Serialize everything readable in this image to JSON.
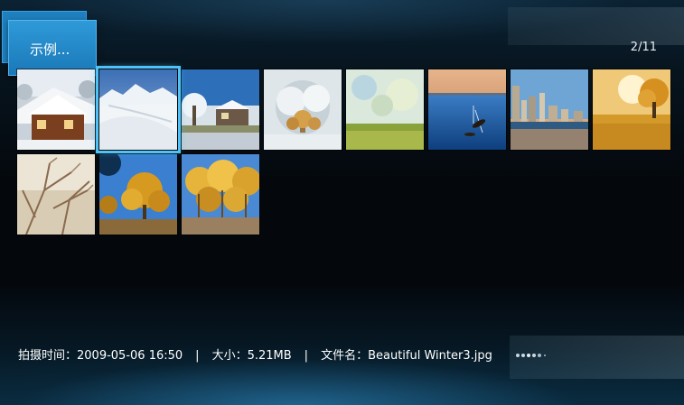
{
  "header": {
    "folder_label": "示例...",
    "page_indicator": "2/11"
  },
  "thumbnails": [
    {
      "name": "thumb-snow-cabin",
      "scene": "snow cabin"
    },
    {
      "name": "thumb-snow-slope",
      "scene": "snow slope",
      "selected": true
    },
    {
      "name": "thumb-winter-house",
      "scene": "winter house"
    },
    {
      "name": "thumb-frost-tree",
      "scene": "frost tree"
    },
    {
      "name": "thumb-green-field",
      "scene": "green field"
    },
    {
      "name": "thumb-sunset-boat",
      "scene": "sunset boat"
    },
    {
      "name": "thumb-city-waterfront",
      "scene": "city waterfront"
    },
    {
      "name": "thumb-autumn-tree",
      "scene": "autumn tree"
    },
    {
      "name": "thumb-bare-branches",
      "scene": "bare branches"
    },
    {
      "name": "thumb-yellow-trees",
      "scene": "yellow trees"
    },
    {
      "name": "thumb-golden-forest",
      "scene": "golden forest"
    }
  ],
  "status": {
    "capture_time_label": "拍摄时间：",
    "capture_time_value": "2009-05-06 16:50",
    "separator": "|",
    "size_label": "大小：",
    "size_value": "5.21MB",
    "filename_label": "文件名：",
    "filename_value": "Beautiful Winter3.jpg"
  },
  "colors": {
    "accent": "#1a78b8",
    "selection": "#4fc3f7"
  }
}
